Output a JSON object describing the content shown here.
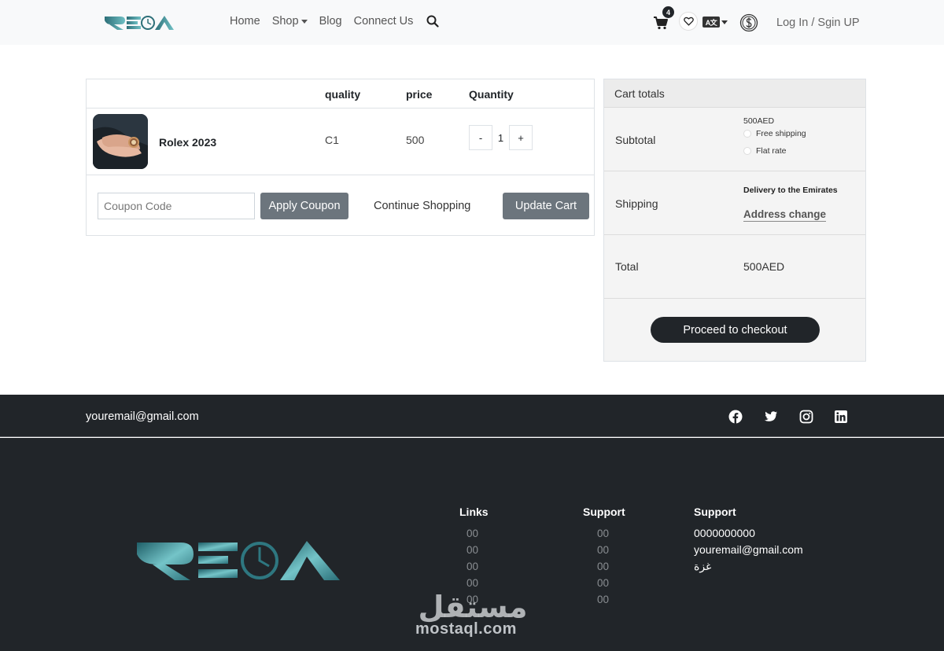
{
  "header": {
    "nav": [
      "Home",
      "Shop",
      "Blog",
      "Connect Us"
    ],
    "cart_count": "4",
    "lang_label": "A文",
    "login_label": "Log In / Sgin UP"
  },
  "cart": {
    "columns": {
      "quality": "quality",
      "price": "price",
      "quantity": "Quantity"
    },
    "item": {
      "name": "Rolex 2023",
      "quality": "C1",
      "price": "500",
      "quantity": "1"
    },
    "minus_label": "-",
    "plus_label": "+",
    "coupon_placeholder": "Coupon Code",
    "apply_label": "Apply Coupon",
    "continue_label": "Continue Shopping",
    "update_label": "Update Cart"
  },
  "totals": {
    "title": "Cart totals",
    "subtotal_label": "Subtotal",
    "subtotal_amount": "500AED",
    "shipping_options": [
      "Free shipping",
      "Flat rate"
    ],
    "shipping_label": "Shipping",
    "shipping_title": "Delivery to the Emirates",
    "address_change": "Address change",
    "total_label": "Total",
    "total_value": "500AED",
    "checkout_label": "Proceed to checkout"
  },
  "footer": {
    "email": "youremail@gmail.com",
    "social": [
      "facebook-icon",
      "twitter-icon",
      "instagram-icon",
      "linkedin-icon"
    ],
    "links_title": "Links",
    "links": [
      "00",
      "00",
      "00",
      "00",
      "00"
    ],
    "support_title": "Support",
    "support_links": [
      "00",
      "00",
      "00",
      "00",
      "00"
    ],
    "contact_title": "Support",
    "contact": [
      "0000000000",
      "youremail@gmail.com",
      "غزة"
    ],
    "watermark_text": "mostaql.com",
    "watermark_arabic": "مستقل"
  },
  "colors": {
    "dark": "#212529",
    "gray_button": "#6c757d",
    "brand_teal": "#3a8f98"
  }
}
